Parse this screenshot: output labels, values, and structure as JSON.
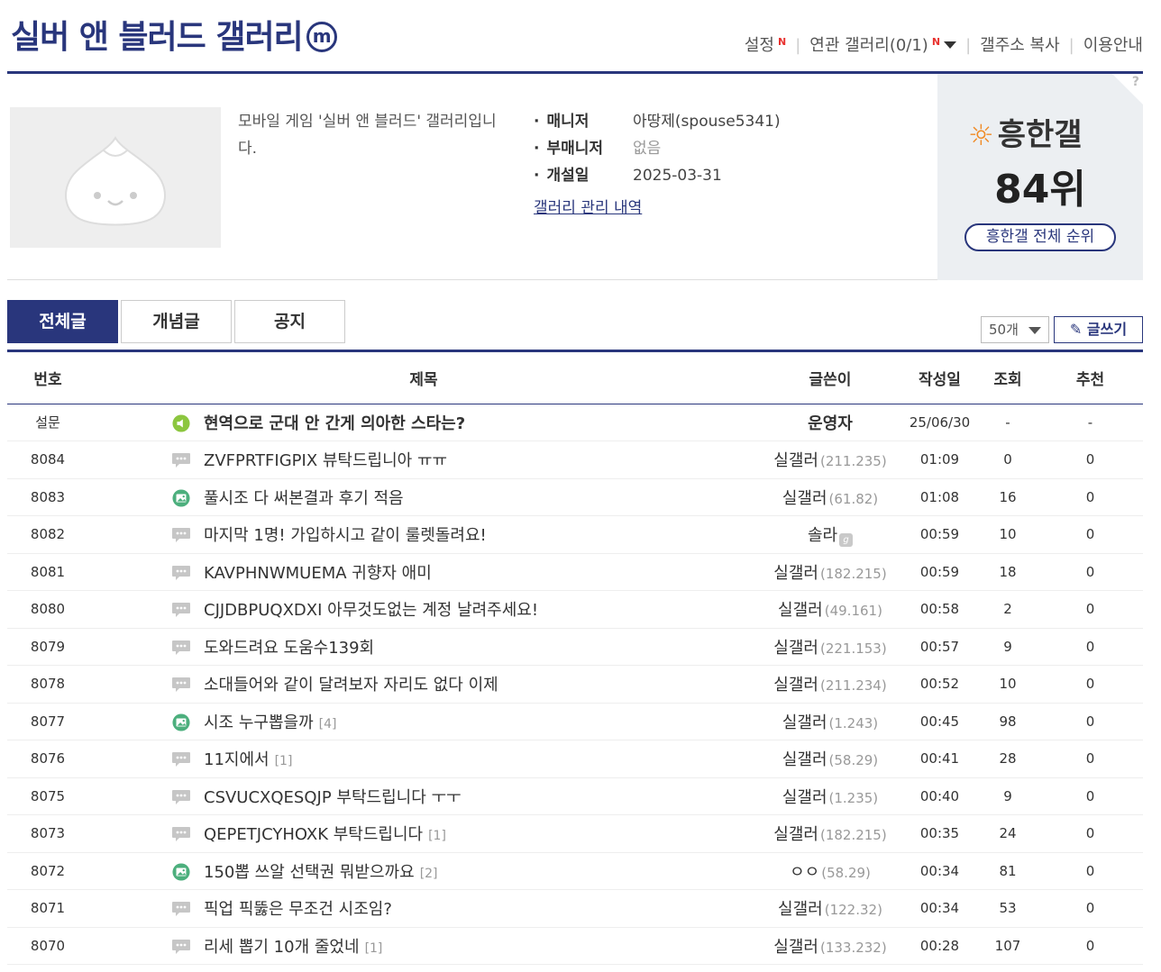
{
  "header": {
    "title": "실버 앤 블러드 갤러리",
    "title_badge": "m",
    "links": {
      "settings": "설정",
      "settings_new": "N",
      "related": "연관 갤러리(0/1)",
      "related_new": "N",
      "copy_url": "갤주소 복사",
      "guide": "이용안내"
    }
  },
  "info": {
    "description": "모바일 게임 '실버 앤 블러드' 갤러리입니다.",
    "manager_label": "매니저",
    "manager_value": "아땅제(spouse5341)",
    "submanager_label": "부매니저",
    "submanager_value": "없음",
    "opened_label": "개설일",
    "opened_value": "2025-03-31",
    "history_link": "갤러리 관리 내역"
  },
  "rank": {
    "brand": "흥한갤",
    "rank_text": "84위",
    "all_button": "흥한갤 전체 순위",
    "help": "?"
  },
  "tabs": [
    {
      "label": "전체글",
      "active": true
    },
    {
      "label": "개념글",
      "active": false
    },
    {
      "label": "공지",
      "active": false
    }
  ],
  "list_count": "50개",
  "write_label": "글쓰기",
  "columns": {
    "no": "번호",
    "subject": "제목",
    "writer": "글쓴이",
    "date": "작성일",
    "views": "조회",
    "recommend": "추천"
  },
  "posts": [
    {
      "no": "설문",
      "icon": "survey",
      "subject": "현역으로 군대 안 간게 의아한 스타는?",
      "comments": "",
      "writer": "운영자",
      "ip": "",
      "writer_bold": true,
      "date": "25/06/30",
      "views": "-",
      "recommend": "-"
    },
    {
      "no": "8084",
      "icon": "text",
      "subject": "ZVFPRTFIGPIX 뷰탁드립니아 ㅠㅠ",
      "comments": "",
      "writer": "실갤러",
      "ip": "(211.235)",
      "date": "01:09",
      "views": "0",
      "recommend": "0"
    },
    {
      "no": "8083",
      "icon": "image",
      "subject": "풀시조 다 써본결과 후기 적음",
      "comments": "",
      "writer": "실갤러",
      "ip": "(61.82)",
      "date": "01:08",
      "views": "16",
      "recommend": "0"
    },
    {
      "no": "8082",
      "icon": "text",
      "subject": "마지막 1명! 가입하시고 같이 룰렛돌려요!",
      "comments": "",
      "writer": "솔라",
      "ip": "",
      "gonic": true,
      "date": "00:59",
      "views": "10",
      "recommend": "0"
    },
    {
      "no": "8081",
      "icon": "text",
      "subject": "KAVPHNWMUEMA 귀향자 애미",
      "comments": "",
      "writer": "실갤러",
      "ip": "(182.215)",
      "date": "00:59",
      "views": "18",
      "recommend": "0"
    },
    {
      "no": "8080",
      "icon": "text",
      "subject": "CJJDBPUQXDXI 아무것도없는 계정 날려주세요!",
      "comments": "",
      "writer": "실갤러",
      "ip": "(49.161)",
      "date": "00:58",
      "views": "2",
      "recommend": "0"
    },
    {
      "no": "8079",
      "icon": "text",
      "subject": "도와드려요 도움수139회",
      "comments": "",
      "writer": "실갤러",
      "ip": "(221.153)",
      "date": "00:57",
      "views": "9",
      "recommend": "0"
    },
    {
      "no": "8078",
      "icon": "text",
      "subject": "소대들어와 같이 달려보자 자리도 없다 이제",
      "comments": "",
      "writer": "실갤러",
      "ip": "(211.234)",
      "date": "00:52",
      "views": "10",
      "recommend": "0"
    },
    {
      "no": "8077",
      "icon": "image",
      "subject": "시조 누구뽑을까",
      "comments": "[4]",
      "writer": "실갤러",
      "ip": "(1.243)",
      "date": "00:45",
      "views": "98",
      "recommend": "0"
    },
    {
      "no": "8076",
      "icon": "text",
      "subject": "11지에서",
      "comments": "[1]",
      "writer": "실갤러",
      "ip": "(58.29)",
      "date": "00:41",
      "views": "28",
      "recommend": "0"
    },
    {
      "no": "8075",
      "icon": "text",
      "subject": "CSVUCXQESQJP 부탁드립니다 ㅜㅜ",
      "comments": "",
      "writer": "실갤러",
      "ip": "(1.235)",
      "date": "00:40",
      "views": "9",
      "recommend": "0"
    },
    {
      "no": "8073",
      "icon": "text",
      "subject": "QEPETJCYHOXK 부탁드립니다",
      "comments": "[1]",
      "writer": "실갤러",
      "ip": "(182.215)",
      "date": "00:35",
      "views": "24",
      "recommend": "0"
    },
    {
      "no": "8072",
      "icon": "image",
      "subject": "150뽑 쓰알 선택권 뭐받으까요",
      "comments": "[2]",
      "writer": "ㅇㅇ",
      "ip": "(58.29)",
      "date": "00:34",
      "views": "81",
      "recommend": "0"
    },
    {
      "no": "8071",
      "icon": "text",
      "subject": "픽업 픽뚫은 무조건 시조임?",
      "comments": "",
      "writer": "실갤러",
      "ip": "(122.32)",
      "date": "00:34",
      "views": "53",
      "recommend": "0"
    },
    {
      "no": "8070",
      "icon": "text",
      "subject": "리세 뽑기 10개 줄었네",
      "comments": "[1]",
      "writer": "실갤러",
      "ip": "(133.232)",
      "date": "00:28",
      "views": "107",
      "recommend": "0"
    }
  ]
}
